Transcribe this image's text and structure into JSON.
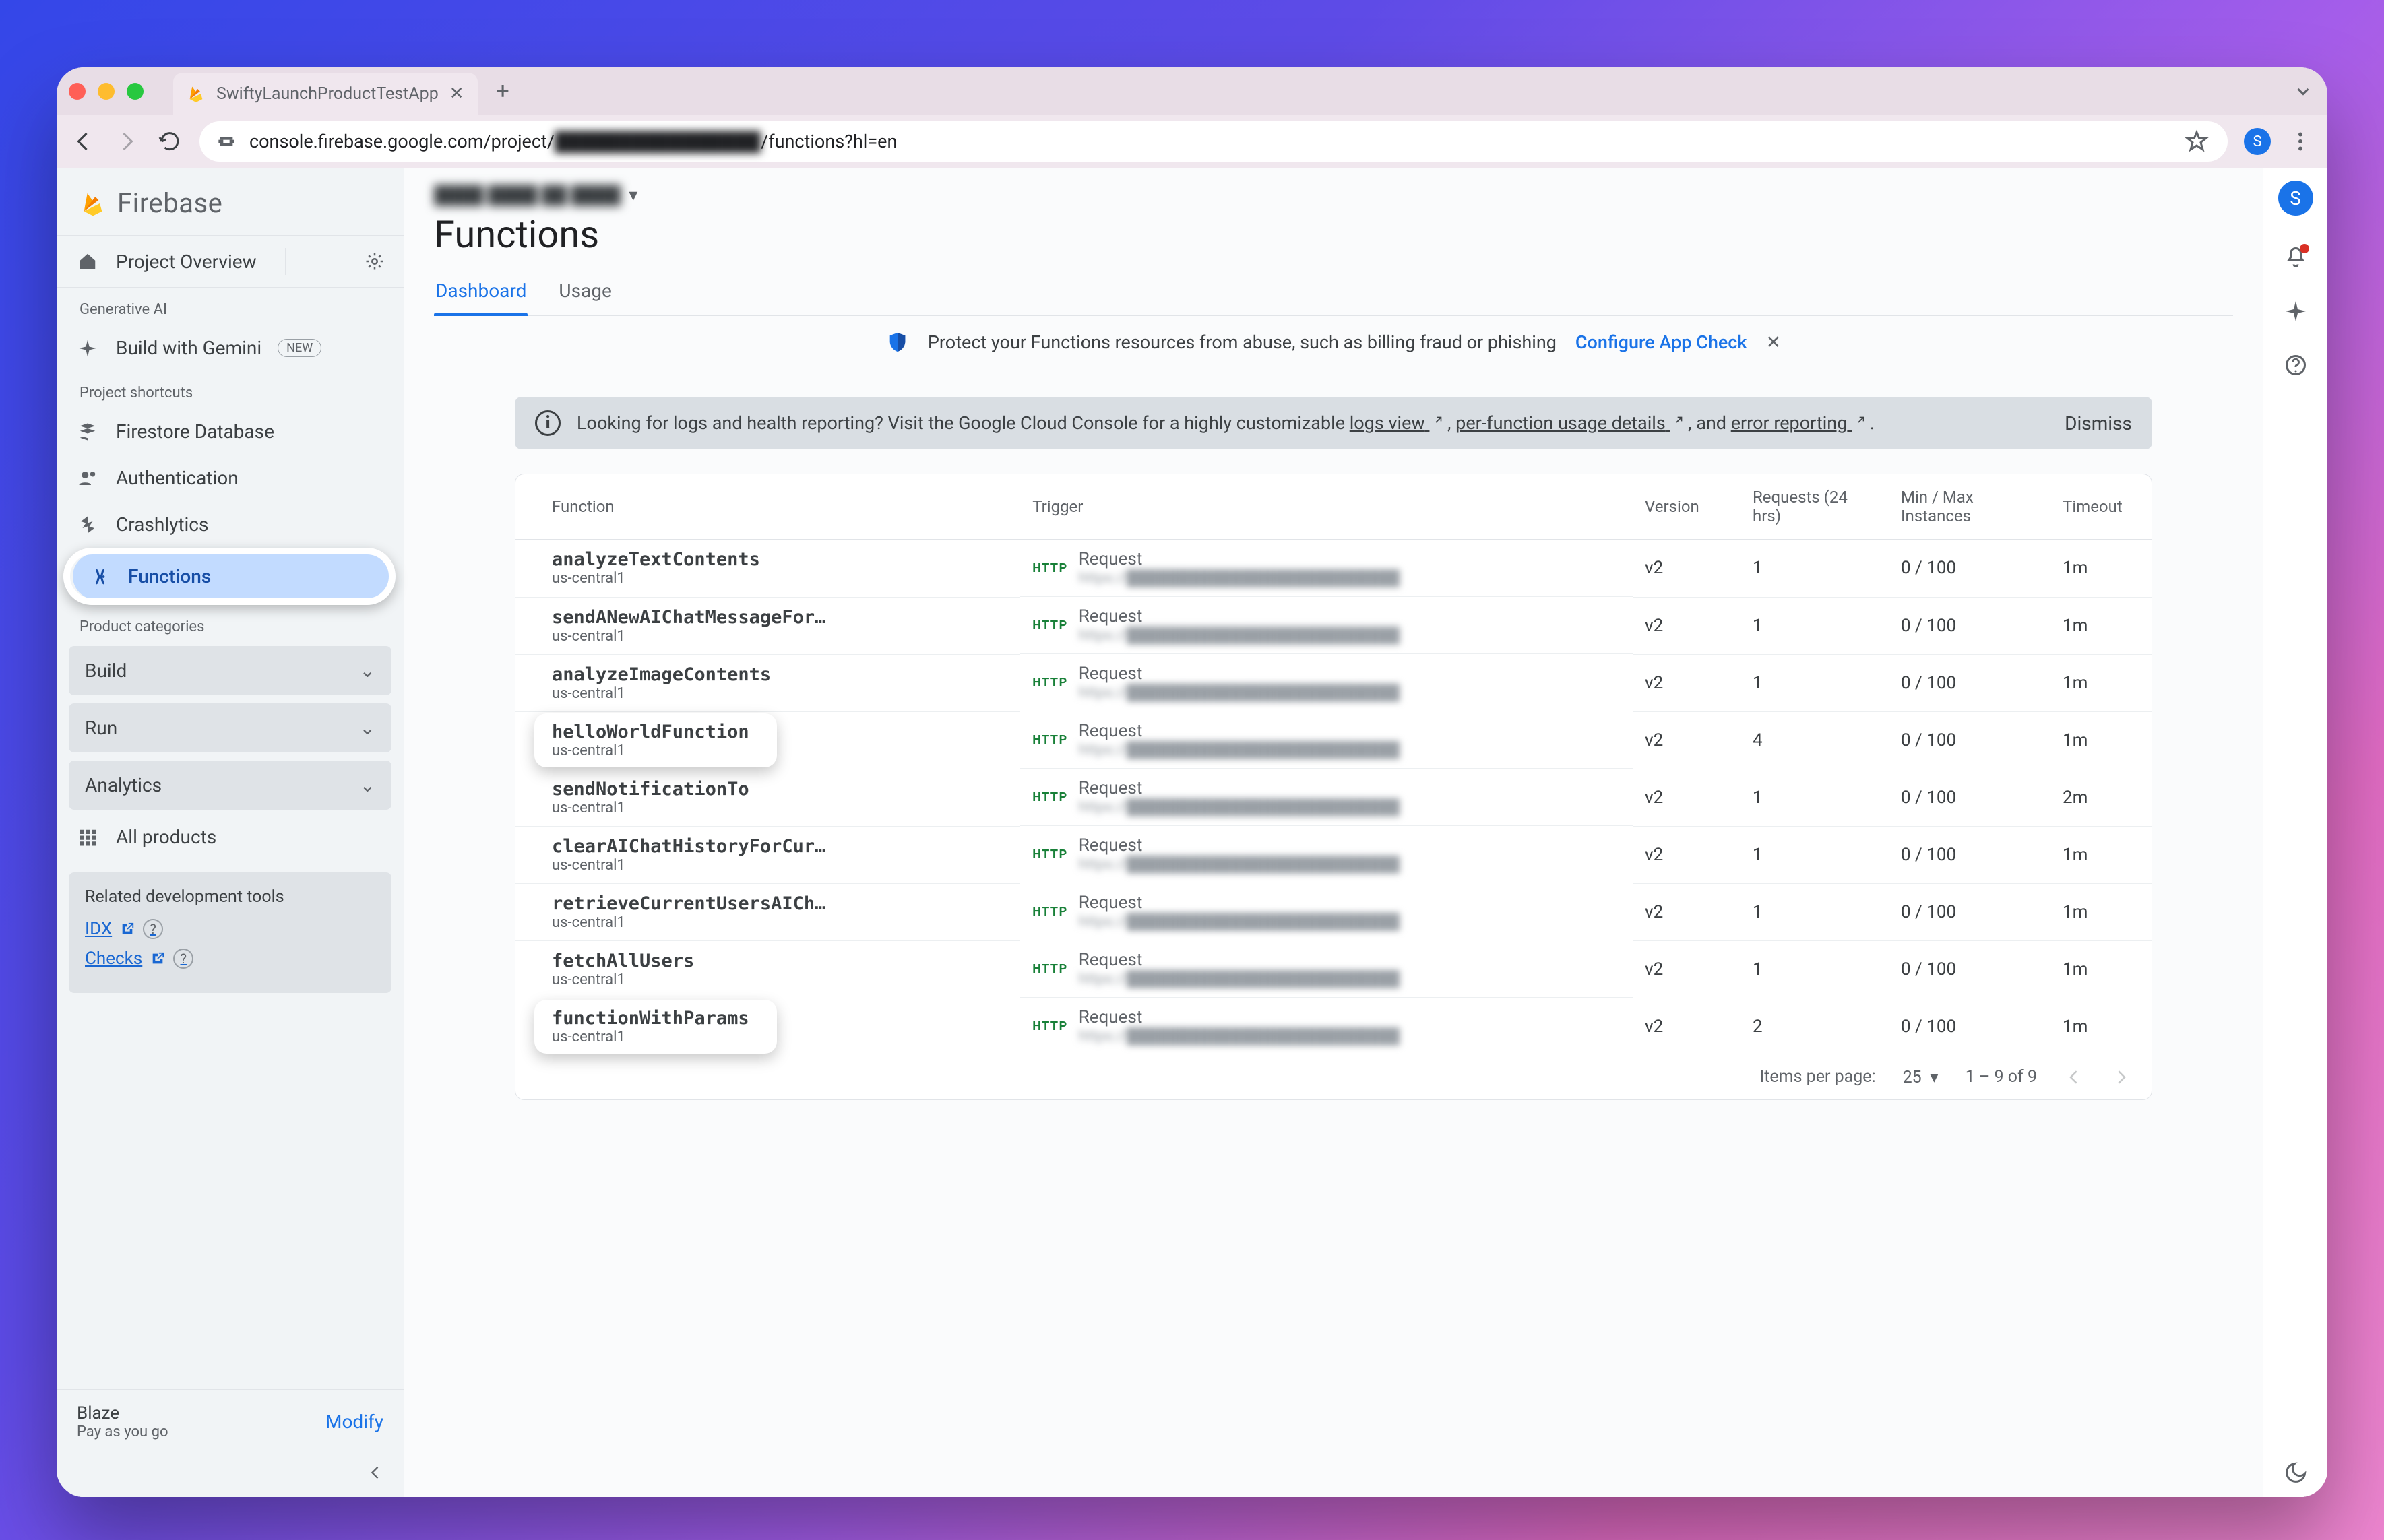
{
  "browser": {
    "tab_title": "SwiftyLaunchProductTestApp",
    "url_pre": "console.firebase.google.com/project/",
    "url_blur": "████████████████",
    "url_post": "/functions?hl=en"
  },
  "brand": "Firebase",
  "sidebar": {
    "overview": "Project Overview",
    "gen_ai_label": "Generative AI",
    "gemini": "Build with Gemini",
    "new_badge": "NEW",
    "shortcuts_label": "Project shortcuts",
    "shortcuts": [
      "Firestore Database",
      "Authentication",
      "Crashlytics",
      "Functions"
    ],
    "categories_label": "Product categories",
    "categories": [
      "Build",
      "Run",
      "Analytics"
    ],
    "all_products": "All products",
    "rel_tools_title": "Related development tools",
    "rel_links": [
      "IDX",
      "Checks"
    ],
    "plan_name": "Blaze",
    "plan_sub": "Pay as you go",
    "modify": "Modify"
  },
  "breadcrumb_blur": "████ ████ ██ ████",
  "page_title": "Functions",
  "tabs": [
    "Dashboard",
    "Usage"
  ],
  "appcheck": {
    "text": "Protect your Functions resources from abuse, such as billing fraud or phishing",
    "action": "Configure App Check"
  },
  "banner": {
    "pre": "Looking for logs and health reporting? Visit the Google Cloud Console for a highly customizable ",
    "l1": "logs view",
    "m1": " , ",
    "l2": "per-function usage details",
    "m2": " , and ",
    "l3": "error reporting",
    "post": " .",
    "dismiss": "Dismiss"
  },
  "table": {
    "cols": [
      "Function",
      "Trigger",
      "Version",
      "Requests (24 hrs)",
      "Min / Max Instances",
      "Timeout"
    ],
    "trigger_label": "Request",
    "rows": [
      {
        "name": "analyzeTextContents",
        "loc": "us-central1",
        "ver": "v2",
        "req": "1",
        "inst": "0 / 100",
        "to": "1m",
        "hl": false
      },
      {
        "name": "sendANewAIChatMessageForCurrentU…",
        "loc": "us-central1",
        "ver": "v2",
        "req": "1",
        "inst": "0 / 100",
        "to": "1m",
        "hl": false
      },
      {
        "name": "analyzeImageContents",
        "loc": "us-central1",
        "ver": "v2",
        "req": "1",
        "inst": "0 / 100",
        "to": "1m",
        "hl": false
      },
      {
        "name": "helloWorldFunction",
        "loc": "us-central1",
        "ver": "v2",
        "req": "4",
        "inst": "0 / 100",
        "to": "1m",
        "hl": true
      },
      {
        "name": "sendNotificationTo",
        "loc": "us-central1",
        "ver": "v2",
        "req": "1",
        "inst": "0 / 100",
        "to": "2m",
        "hl": false
      },
      {
        "name": "clearAIChatHistoryForCurrentUser",
        "loc": "us-central1",
        "ver": "v2",
        "req": "1",
        "inst": "0 / 100",
        "to": "1m",
        "hl": false
      },
      {
        "name": "retrieveCurrentUsersAIChatMessag…",
        "loc": "us-central1",
        "ver": "v2",
        "req": "1",
        "inst": "0 / 100",
        "to": "1m",
        "hl": false
      },
      {
        "name": "fetchAllUsers",
        "loc": "us-central1",
        "ver": "v2",
        "req": "1",
        "inst": "0 / 100",
        "to": "1m",
        "hl": false
      },
      {
        "name": "functionWithParams",
        "loc": "us-central1",
        "ver": "v2",
        "req": "2",
        "inst": "0 / 100",
        "to": "1m",
        "hl": true
      }
    ]
  },
  "pager": {
    "ipp_label": "Items per page:",
    "ipp_val": "25",
    "range": "1 – 9 of 9"
  },
  "avatar_letter": "S"
}
